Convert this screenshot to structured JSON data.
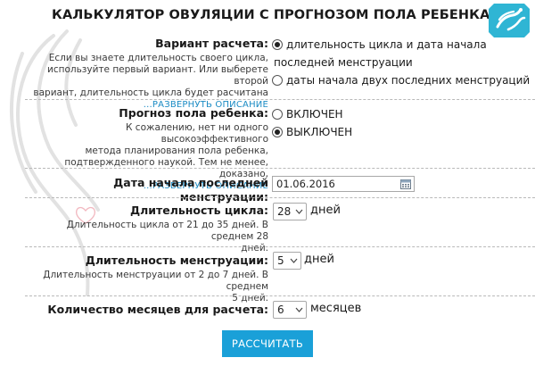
{
  "title": "КАЛЬКУЛЯТОР ОВУЛЯЦИИ С ПРОГНОЗОМ ПОЛА РЕБЕНКА",
  "colors": {
    "accent": "#1aa0d8",
    "link": "#1a8bc4",
    "badge": "#2fb5d4"
  },
  "calc_mode": {
    "label": "Вариант расчета:",
    "desc_lines": [
      "Если вы знаете длительность своего цикла,",
      "используйте первый вариант. Или выберете второй",
      "вариант, длительность цикла будет расчитана"
    ],
    "expand": "...РАЗВЕРНУТЬ ОПИСАНИЕ",
    "options": [
      {
        "lines": [
          "длительность цикла и дата начала",
          "последней менструации"
        ],
        "selected": true
      },
      {
        "lines": [
          "даты начала двух последних менструаций"
        ],
        "selected": false
      }
    ]
  },
  "gender": {
    "label": "Прогноз пола ребенка:",
    "desc_lines": [
      "К сожалению, нет ни одного высокоэффективного",
      "метода планирования пола ребенка,",
      "подтвержденного наукой. Тем не менее, доказано,"
    ],
    "expand": "...РАЗВЕРНУТЬ ОПИСАНИЕ",
    "options": [
      {
        "label": "ВКЛЮЧЕН",
        "selected": false
      },
      {
        "label": "ВЫКЛЮЧЕН",
        "selected": true
      }
    ]
  },
  "last_period": {
    "label": "Дата начала последней менструации:",
    "value": "01.06.2016"
  },
  "cycle": {
    "label": "Длительность цикла:",
    "desc_lines": [
      "Длительность цикла от 21 до 35 дней. В среднем 28",
      "дней."
    ],
    "value": "28",
    "unit": "дней"
  },
  "period": {
    "label": "Длительность менструации:",
    "desc_lines": [
      "Длительность менструации от 2 до 7 дней. В среднем",
      "5 дней."
    ],
    "value": "5",
    "unit": "дней"
  },
  "months": {
    "label": "Количество месяцев для расчета:",
    "value": "6",
    "unit": "месяцев"
  },
  "submit": "РАССЧИТАТЬ"
}
